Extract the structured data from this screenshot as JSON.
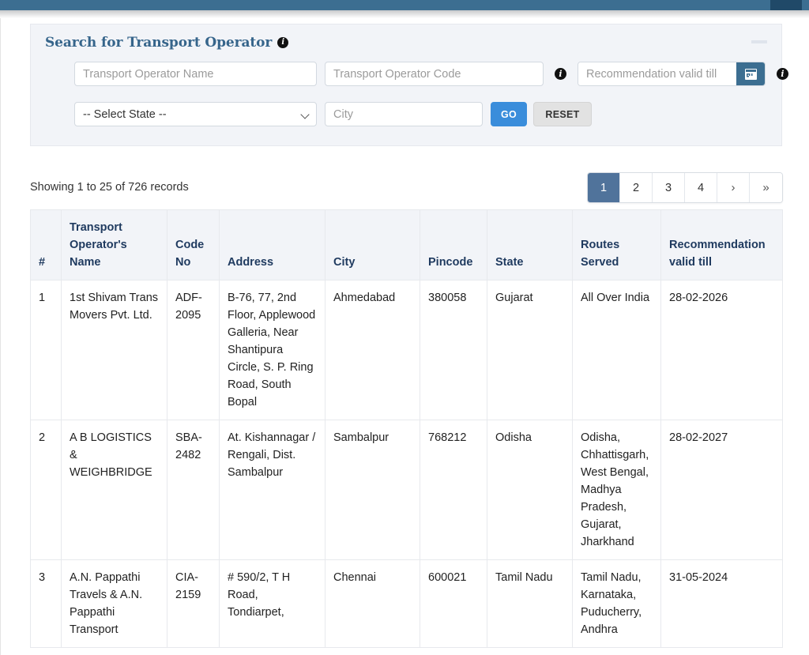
{
  "chrome": {
    "bar_color": "#3c6e91",
    "bar_accent_color": "#204968"
  },
  "search_panel": {
    "title": "Search for Transport Operator",
    "title_info_icon": "info-icon",
    "collapse_icon": "minus-icon",
    "fields": {
      "operator_name_placeholder": "Transport Operator Name",
      "operator_name_value": "",
      "operator_code_placeholder": "Transport Operator Code",
      "operator_code_value": "",
      "operator_code_info_icon": "info-icon",
      "recommendation_placeholder": "Recommendation valid till",
      "recommendation_value": "",
      "calendar_icon": "calendar-icon",
      "recommendation_info_icon": "info-icon",
      "state_selected": "-- Select State --",
      "state_options": [
        "-- Select State --"
      ],
      "city_placeholder": "City",
      "city_value": ""
    },
    "buttons": {
      "go_label": "GO",
      "go_color": "#3a8ddb",
      "reset_label": "RESET",
      "reset_color": "#e2e2e2"
    }
  },
  "results": {
    "showing_text": "Showing 1 to 25 of 726 records",
    "pagination": {
      "pages": [
        "1",
        "2",
        "3",
        "4"
      ],
      "active": "1",
      "next_label": "›",
      "last_label": "»",
      "active_color": "#50739b"
    },
    "columns": [
      "#",
      "Transport Operator's Name",
      "Code No",
      "Address",
      "City",
      "Pincode",
      "State",
      "Routes Served",
      "Recommendation valid till"
    ],
    "rows": [
      {
        "index": "1",
        "name": "1st Shivam Trans Movers Pvt. Ltd.",
        "code": "ADF-2095",
        "address": "B-76, 77, 2nd Floor, Applewood Galleria, Near Shantipura Circle, S. P. Ring Road, South Bopal",
        "city": "Ahmedabad",
        "pincode": "380058",
        "state": "Gujarat",
        "routes": "All Over India",
        "valid_till": "28-02-2026"
      },
      {
        "index": "2",
        "name": "A B LOGISTICS & WEIGHBRIDGE",
        "code": "SBA-2482",
        "address": "At. Kishannagar / Rengali, Dist. Sambalpur",
        "city": "Sambalpur",
        "pincode": "768212",
        "state": "Odisha",
        "routes": "Odisha, Chhattisgarh, West Bengal, Madhya Pradesh, Gujarat, Jharkhand",
        "valid_till": "28-02-2027"
      },
      {
        "index": "3",
        "name": "A.N. Pappathi Travels & A.N. Pappathi Transport",
        "code": "CIA-2159",
        "address": "# 590/2, T H Road, Tondiarpet,",
        "city": "Chennai",
        "pincode": "600021",
        "state": "Tamil Nadu",
        "routes": "Tamil Nadu, Karnataka, Puducherry, Andhra",
        "valid_till": "31-05-2024"
      }
    ]
  }
}
